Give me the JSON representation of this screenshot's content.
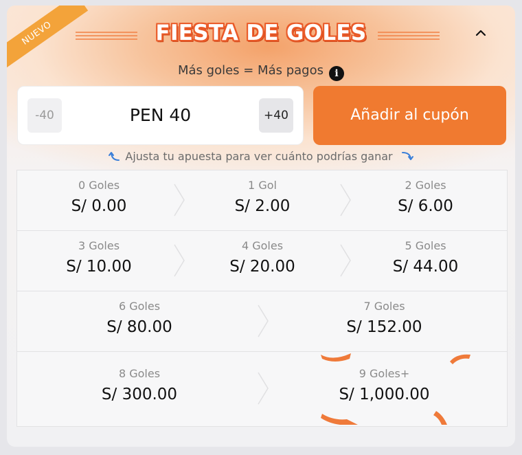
{
  "badge": "NUEVO",
  "title": "FIESTA DE GOLES",
  "subtitle": "Más goles = Más pagos",
  "stake": {
    "minus_label": "-40",
    "value": "PEN 40",
    "plus_label": "+40"
  },
  "add_button": "Añadir al cupón",
  "hint": "Ajusta tu apuesta para ver cuánto podrías ganar",
  "colors": {
    "accent": "#f07a30",
    "title_outline": "#ea5a28",
    "badge": "#f3a33a"
  },
  "payouts": [
    [
      {
        "goals": "0 Goles",
        "amount": "S/ 0.00"
      },
      {
        "goals": "1 Gol",
        "amount": "S/ 2.00"
      },
      {
        "goals": "2 Goles",
        "amount": "S/ 6.00"
      }
    ],
    [
      {
        "goals": "3 Goles",
        "amount": "S/ 10.00"
      },
      {
        "goals": "4 Goles",
        "amount": "S/ 20.00"
      },
      {
        "goals": "5 Goles",
        "amount": "S/ 44.00"
      }
    ],
    [
      {
        "goals": "6 Goles",
        "amount": "S/ 80.00"
      },
      {
        "goals": "7 Goles",
        "amount": "S/ 152.00"
      }
    ],
    [
      {
        "goals": "8 Goles",
        "amount": "S/ 300.00"
      },
      {
        "goals": "9 Goles+",
        "amount": "S/ 1,000.00"
      }
    ]
  ]
}
